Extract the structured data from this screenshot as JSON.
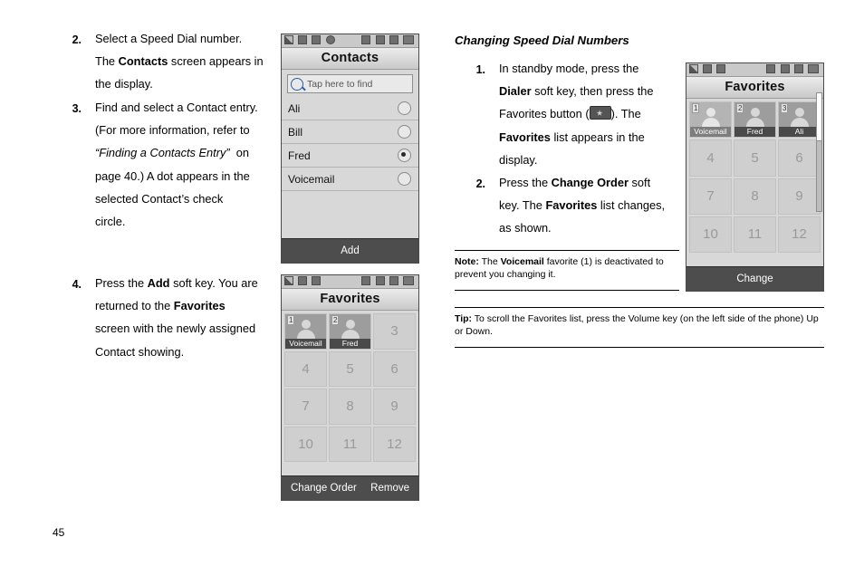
{
  "page_number": "45",
  "left_column": {
    "steps": [
      {
        "num": "2.",
        "lines": [
          "Select a Speed Dial number.",
          "The <b>Contacts</b> screen appears in",
          "the display."
        ]
      },
      {
        "num": "3.",
        "lines": [
          "Find and select a Contact entry.",
          "(For more information, refer to",
          "<i>“Finding a Contacts Entry”</i>&nbsp; on",
          "page 40.) A dot appears in the",
          "selected Contact’s check",
          "circle."
        ]
      },
      {
        "num": "4.",
        "lines": [
          "Press the <b>Add</b> soft key. You are",
          "returned to the <b>Favorites</b>",
          "screen with the newly assigned",
          "Contact showing."
        ]
      }
    ]
  },
  "right_column": {
    "section_title": "Changing Speed Dial Numbers",
    "steps": [
      {
        "num": "1.",
        "lines": [
          "In standby mode, press the",
          "<b>Dialer</b> soft key, then press the",
          "Favorites button (<span class=\"keyimg\" data-name=\"favorites-key-icon\" data-interactable=\"false\"></span>). The",
          "<b>Favorites</b> list appears in the",
          "display."
        ]
      },
      {
        "num": "2.",
        "lines": [
          "Press the <b>Change Order</b> soft",
          "key. The <b>Favorites</b> list changes,",
          "as shown."
        ]
      }
    ],
    "note": {
      "lead": "Note:",
      "body": "The <b>Voicemail</b> favorite (1) is deactivated to prevent you changing it."
    },
    "tip": {
      "lead": "Tip:",
      "body": "To scroll the Favorites list, press the Volume key (on the left side of the phone) Up or Down."
    }
  },
  "screens": {
    "contacts": {
      "title": "Contacts",
      "search_placeholder": "Tap here to find",
      "rows": [
        {
          "label": "Ali",
          "selected": false
        },
        {
          "label": "Bill",
          "selected": false
        },
        {
          "label": "Fred",
          "selected": true
        },
        {
          "label": "Voicemail",
          "selected": false
        }
      ],
      "softkey_center": "Add"
    },
    "favorites_edit": {
      "title": "Favorites",
      "cells": [
        {
          "index": "1",
          "label": "Voicemail",
          "photo": true,
          "dim": false
        },
        {
          "index": "2",
          "label": "Fred",
          "photo": true,
          "dim": false
        },
        {
          "index": "",
          "label": "3",
          "photo": false,
          "dim": false
        },
        {
          "index": "",
          "label": "4",
          "photo": false,
          "dim": false
        },
        {
          "index": "",
          "label": "5",
          "photo": false,
          "dim": false
        },
        {
          "index": "",
          "label": "6",
          "photo": false,
          "dim": false
        },
        {
          "index": "",
          "label": "7",
          "photo": false,
          "dim": false
        },
        {
          "index": "",
          "label": "8",
          "photo": false,
          "dim": false
        },
        {
          "index": "",
          "label": "9",
          "photo": false,
          "dim": false
        },
        {
          "index": "",
          "label": "10",
          "photo": false,
          "dim": false
        },
        {
          "index": "",
          "label": "11",
          "photo": false,
          "dim": false
        },
        {
          "index": "",
          "label": "12",
          "photo": false,
          "dim": false
        }
      ],
      "softkey_left": "Change Order",
      "softkey_right": "Remove"
    },
    "favorites_change": {
      "title": "Favorites",
      "cells": [
        {
          "index": "1",
          "label": "Voicemail",
          "photo": true,
          "dim": true
        },
        {
          "index": "2",
          "label": "Fred",
          "photo": true,
          "dim": false
        },
        {
          "index": "3",
          "label": "Ali",
          "photo": true,
          "dim": false
        },
        {
          "index": "",
          "label": "4",
          "photo": false,
          "dim": false
        },
        {
          "index": "",
          "label": "5",
          "photo": false,
          "dim": false
        },
        {
          "index": "",
          "label": "6",
          "photo": false,
          "dim": false
        },
        {
          "index": "",
          "label": "7",
          "photo": false,
          "dim": false
        },
        {
          "index": "",
          "label": "8",
          "photo": false,
          "dim": false
        },
        {
          "index": "",
          "label": "9",
          "photo": false,
          "dim": false
        },
        {
          "index": "",
          "label": "10",
          "photo": false,
          "dim": false
        },
        {
          "index": "",
          "label": "11",
          "photo": false,
          "dim": false
        },
        {
          "index": "",
          "label": "12",
          "photo": false,
          "dim": false
        }
      ],
      "softkey_center": "Change"
    }
  }
}
